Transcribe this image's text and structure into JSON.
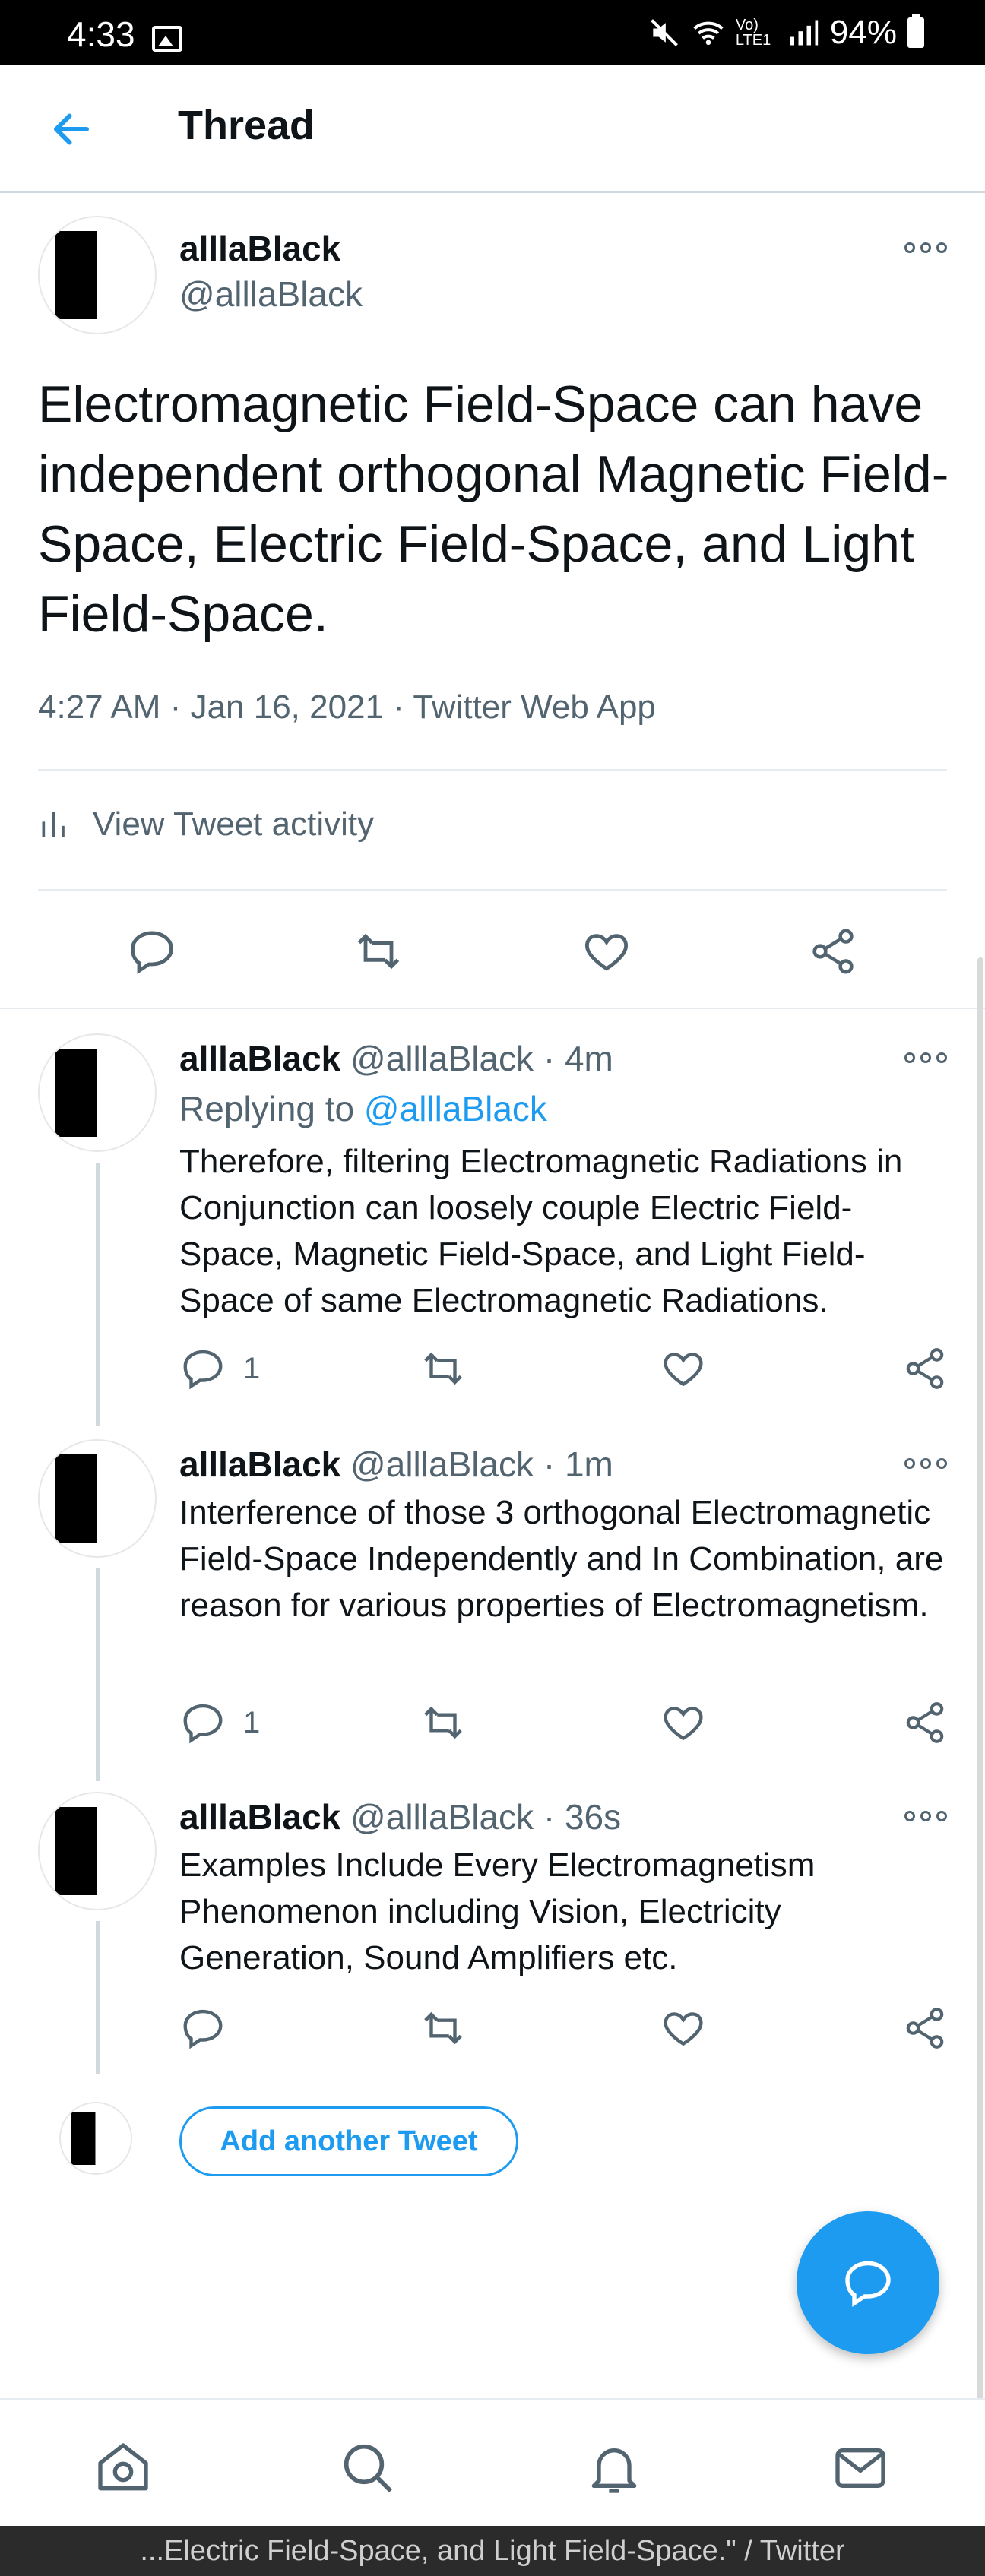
{
  "status": {
    "time": "4:33",
    "network": "Vo) LTE1",
    "battery": "94%"
  },
  "header": {
    "title": "Thread"
  },
  "main_tweet": {
    "name": "alllaBlack",
    "handle": "@alllaBlack",
    "text": "Electromagnetic Field-Space can have independent orthogonal Magnetic Field-Space, Electric Field-Space, and Light Field-Space.",
    "time": "4:27 AM",
    "date": "Jan 16, 2021",
    "source": "Twitter Web App",
    "activity_label": "View Tweet activity"
  },
  "replies": [
    {
      "name": "alllaBlack",
      "handle": "@alllaBlack",
      "age": "4m",
      "replying_prefix": "Replying to",
      "replying_to": "@alllaBlack",
      "text": "Therefore, filtering Electromagnetic Radiations in Conjunction can loosely couple Electric Field-Space, Magnetic Field-Space, and Light Field-Space of same Electromagnetic Radiations.",
      "reply_count": "1"
    },
    {
      "name": "alllaBlack",
      "handle": "@alllaBlack",
      "age": "1m",
      "text": "Interference of those 3 orthogonal Electromagnetic Field-Space Independently and In Combination, are reason for various properties of Electromagnetism.",
      "reply_count": "1"
    },
    {
      "name": "alllaBlack",
      "handle": "@alllaBlack",
      "age": "36s",
      "text": "Examples Include Every Electromagnetism Phenomenon including Vision, Electricity Generation, Sound Amplifiers etc.",
      "reply_count": ""
    }
  ],
  "compose": {
    "add_label": "Add another Tweet"
  },
  "footer": {
    "page_title": "...Electric Field-Space, and Light Field-Space.\" / Twitter"
  },
  "colors": {
    "accent": "#1d9bf0",
    "muted": "#536471",
    "text": "#0f1419"
  }
}
